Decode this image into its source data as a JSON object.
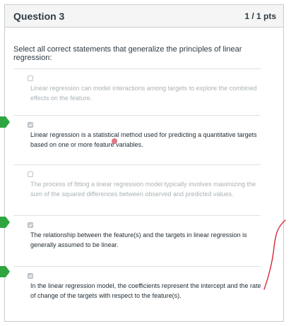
{
  "question": {
    "title": "Question 3",
    "points": "1 / 1 pts",
    "prompt": "Select all correct statements that generalize the principles of linear regression:"
  },
  "answers": [
    {
      "text": "Linear regression can model interactions among targets to explore the combined effects on the feature.",
      "checked": false,
      "correct": false
    },
    {
      "text": "Linear regression is a statistical method used for predicting a quantitative targets based on one or more feature variables.",
      "checked": true,
      "correct": true
    },
    {
      "text": "The process of fitting a linear regression model typically involves maximizing the sum of the squared differences between observed and predicted values.",
      "checked": false,
      "correct": false
    },
    {
      "text": "The relationship between the feature(s) and the targets in linear regression is generally assumed to be linear.",
      "checked": true,
      "correct": true
    },
    {
      "text": "In the linear regression model, the coefficients represent the intercept and the rate of change of the targets with respect to the feature(s).",
      "checked": true,
      "correct": true
    }
  ],
  "colors": {
    "correct_marker": "#2fa53f",
    "header_bg": "#f5f5f5",
    "border": "#c7cdd1",
    "text_dark": "#1f2b33",
    "text_dim": "#aab2b7",
    "annotation": "#d6283a"
  }
}
